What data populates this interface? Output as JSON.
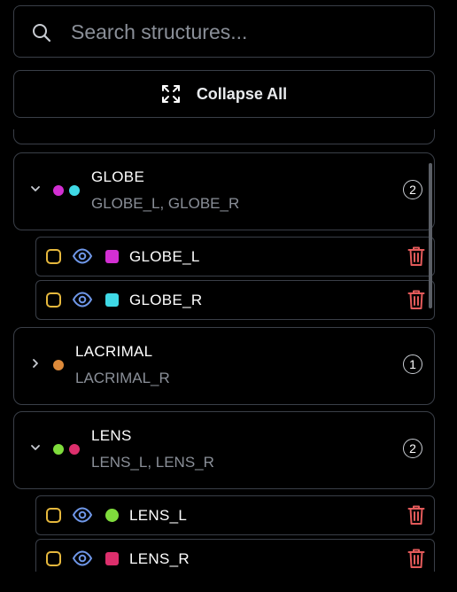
{
  "search": {
    "placeholder": "Search structures...",
    "value": ""
  },
  "toolbar": {
    "collapse_label": "Collapse All"
  },
  "colors": {
    "magenta": "#d22fd2",
    "cyan": "#3fd9e6",
    "orange": "#dd8a3a",
    "green": "#7fdc3c",
    "pink": "#dc2f6c",
    "checkbox": "#e6b83d",
    "eye": "#6f97e8",
    "trash": "#e35a5a"
  },
  "groups": [
    {
      "name": "GLOBE",
      "subtitle": "GLOBE_L, GLOBE_R",
      "count": "2",
      "expanded": true,
      "items": [
        {
          "name": "GLOBE_L"
        },
        {
          "name": "GLOBE_R"
        }
      ]
    },
    {
      "name": "LACRIMAL",
      "subtitle": "LACRIMAL_R",
      "count": "1",
      "expanded": false,
      "items": []
    },
    {
      "name": "LENS",
      "subtitle": "LENS_L, LENS_R",
      "count": "2",
      "expanded": true,
      "items": [
        {
          "name": "LENS_L"
        },
        {
          "name": "LENS_R"
        }
      ]
    }
  ]
}
